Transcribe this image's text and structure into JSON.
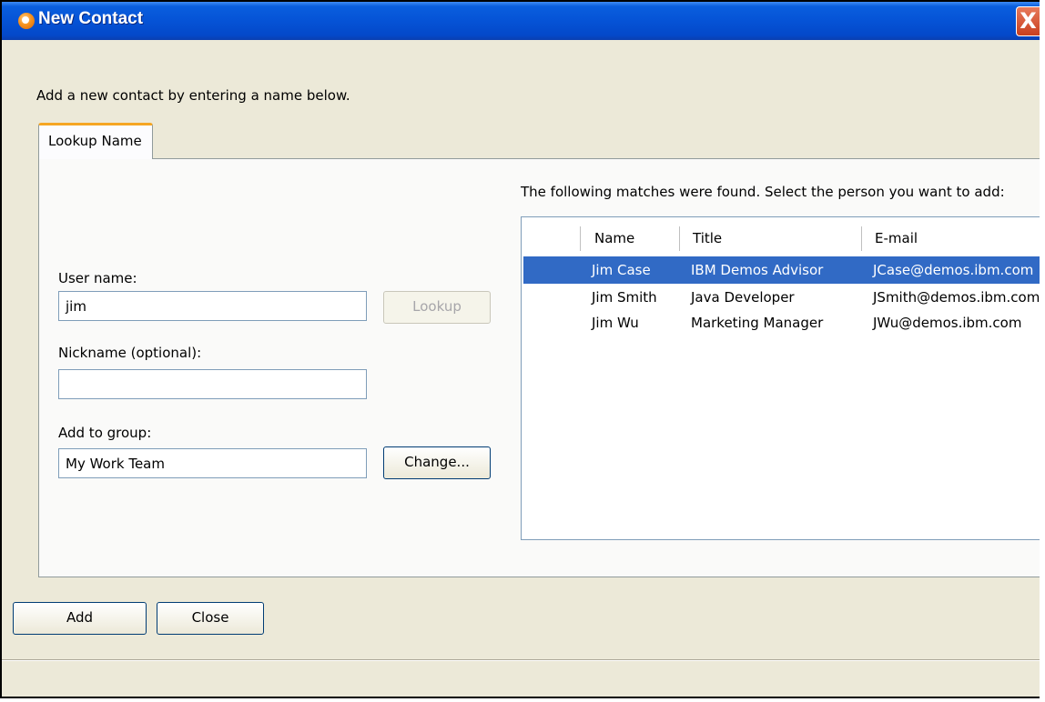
{
  "window": {
    "title": "New Contact",
    "close_glyph": "X",
    "app_icon": "sametime-icon",
    "title_color": "#0553d6"
  },
  "intro_text": "Add a new contact by entering a name below.",
  "tab": {
    "label": "Lookup Name"
  },
  "form": {
    "user_name_label": "User name:",
    "user_name_value": "jim",
    "lookup_button": "Lookup",
    "nickname_label": "Nickname (optional):",
    "nickname_value": "",
    "group_label": "Add to group:",
    "group_value": "My Work Team",
    "change_button": "Change..."
  },
  "results": {
    "prompt": "The following matches were found. Select the person you want to add:",
    "columns": [
      "Name",
      "Title",
      "E-mail"
    ],
    "rows": [
      {
        "name": "Jim Case",
        "title": "IBM Demos Advisor",
        "email": "JCase@demos.ibm.com",
        "selected": true
      },
      {
        "name": "Jim Smith",
        "title": "Java Developer",
        "email": "JSmith@demos.ibm.com",
        "selected": false
      },
      {
        "name": "Jim Wu",
        "title": "Marketing Manager",
        "email": "JWu@demos.ibm.com",
        "selected": false
      }
    ],
    "selection_color": "#316ac5"
  },
  "footer": {
    "add_button": "Add",
    "close_button": "Close"
  }
}
